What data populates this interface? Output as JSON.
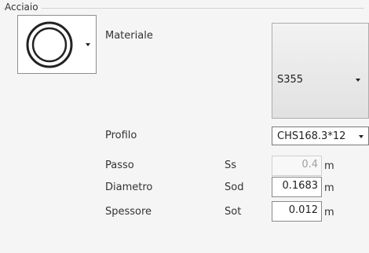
{
  "group": {
    "title": "Acciaio"
  },
  "section_icon": "circular-hollow-section-icon",
  "materiale": {
    "label": "Materiale",
    "value": "S355"
  },
  "profilo": {
    "label": "Profilo",
    "value": "CHS168.3*12"
  },
  "rows": [
    {
      "label": "Passo",
      "symbol": "Ss",
      "value": "0.4",
      "unit": "m",
      "enabled": false
    },
    {
      "label": "Diametro",
      "symbol": "Sod",
      "value": "0.1683",
      "unit": "m",
      "enabled": true
    },
    {
      "label": "Spessore",
      "symbol": "Sot",
      "value": "0.012",
      "unit": "m",
      "enabled": true
    }
  ]
}
